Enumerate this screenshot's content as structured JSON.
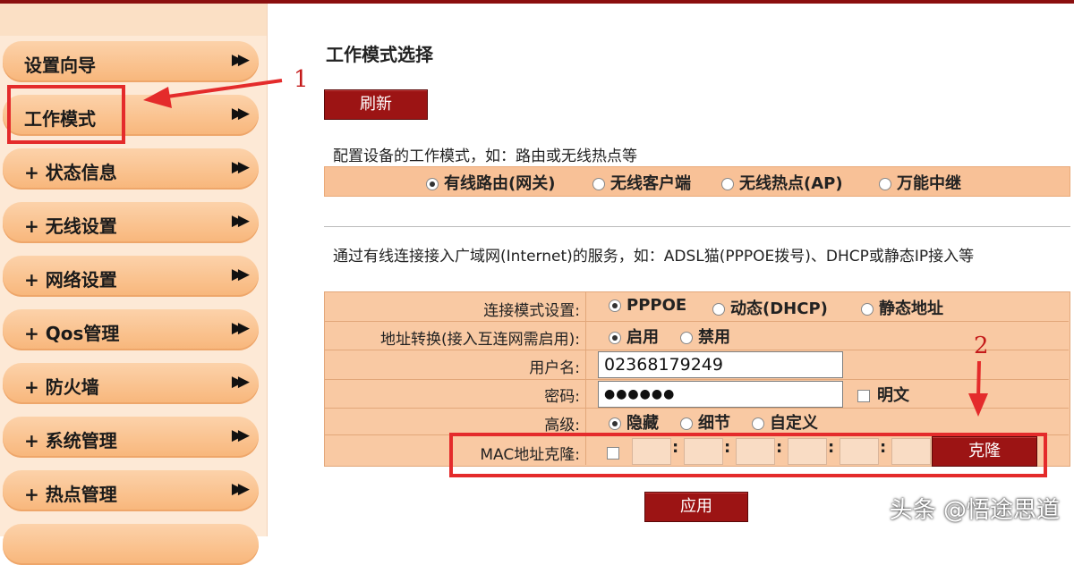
{
  "sidebar": {
    "items": [
      {
        "label": "设置向导",
        "arrow": "▶▶",
        "active": false
      },
      {
        "label": "工作模式",
        "arrow": "▶▶",
        "active": true
      },
      {
        "label": "+ 状态信息",
        "arrow": "▶▶",
        "active": false
      },
      {
        "label": "+ 无线设置",
        "arrow": "▶▶",
        "active": false
      },
      {
        "label": "+ 网络设置",
        "arrow": "▶▶",
        "active": false
      },
      {
        "label": "+ Qos管理",
        "arrow": "▶▶",
        "active": false
      },
      {
        "label": "+ 防火墙",
        "arrow": "▶▶",
        "active": false
      },
      {
        "label": "+ 系统管理",
        "arrow": "▶▶",
        "active": false
      },
      {
        "label": "+ 热点管理",
        "arrow": "▶▶",
        "active": false
      },
      {
        "label": "",
        "arrow": "",
        "active": false
      }
    ]
  },
  "main": {
    "title": "工作模式选择",
    "refresh_label": "刷新",
    "mode_desc": "配置设备的工作模式，如：路由或无线热点等",
    "modes": [
      {
        "label": "有线路由(网关)",
        "selected": true
      },
      {
        "label": "无线客户端",
        "selected": false
      },
      {
        "label": "无线热点(AP)",
        "selected": false
      },
      {
        "label": "万能中继",
        "selected": false
      }
    ],
    "wan_desc": "通过有线连接接入广域网(Internet)的服务，如：ADSL猫(PPPOE拨号)、DHCP或静态IP接入等",
    "form": {
      "conn_mode_label": "连接模式设置:",
      "conn_modes": [
        {
          "label": "PPPOE",
          "selected": true
        },
        {
          "label": "动态(DHCP)",
          "selected": false
        },
        {
          "label": "静态地址",
          "selected": false
        }
      ],
      "nat_label": "地址转换(接入互连网需启用):",
      "nat_options": [
        {
          "label": "启用",
          "selected": true
        },
        {
          "label": "禁用",
          "selected": false
        }
      ],
      "username_label": "用户名:",
      "username_value": "02368179249",
      "password_label": "密码:",
      "password_value": "●●●●●●",
      "plaintext_label": "明文",
      "advanced_label": "高级:",
      "advanced_options": [
        {
          "label": "隐藏",
          "selected": true
        },
        {
          "label": "细节",
          "selected": false
        },
        {
          "label": "自定义",
          "selected": false
        }
      ],
      "mac_clone_label": "MAC地址克隆:",
      "mac_separator": ":",
      "clone_label": "克隆"
    },
    "apply_label": "应用"
  },
  "annotations": {
    "marker_1": "1",
    "marker_2": "2"
  },
  "watermark": "头条 @悟途思道",
  "colors": {
    "accent": "#9c1414",
    "highlight": "#e42b2b",
    "panel": "#f9c9a3"
  }
}
